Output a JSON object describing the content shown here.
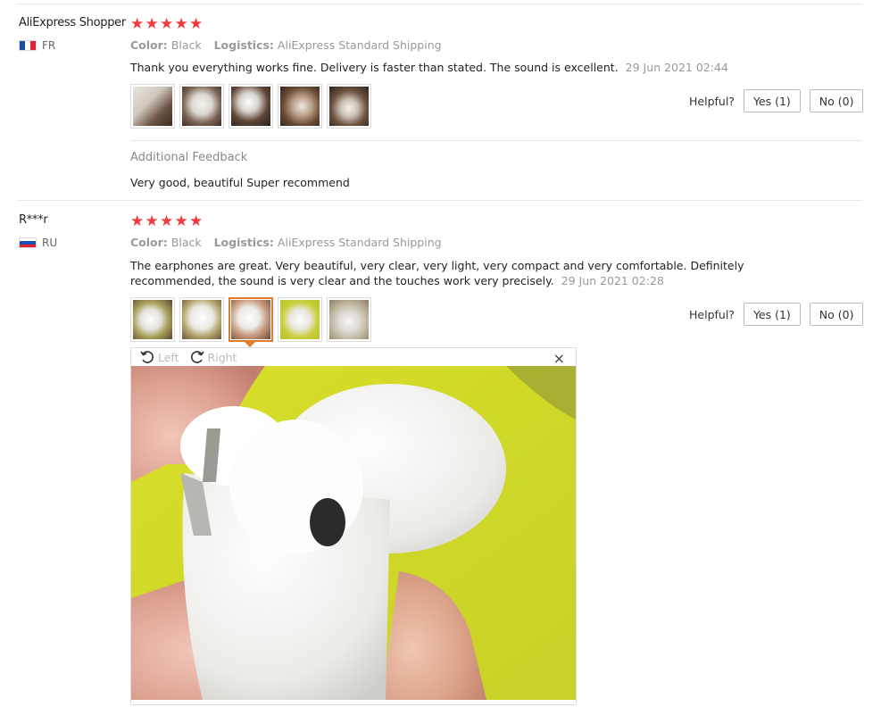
{
  "reviews": [
    {
      "user": "AliExpress Shopper",
      "country": "FR",
      "stars": 5,
      "color_label": "Color:",
      "color_value": "Black",
      "logistics_label": "Logistics:",
      "logistics_value": "AliExpress Standard Shipping",
      "text": "Thank you everything works fine. Delivery is faster than stated. The sound is excellent.",
      "date": "29 Jun 2021 02:44",
      "helpful_label": "Helpful?",
      "yes_label": "Yes (1)",
      "no_label": "No (0)",
      "additional_feedback_title": "Additional Feedback",
      "additional_feedback_text": "Very good, beautiful Super recommend"
    },
    {
      "user": "R***r",
      "country": "RU",
      "stars": 5,
      "color_label": "Color:",
      "color_value": "Black",
      "logistics_label": "Logistics:",
      "logistics_value": "AliExpress Standard Shipping",
      "text_line1": "The earphones are great. Very beautiful, very clear, very light, very compact and very comfortable. Definitely",
      "text_line2": "recommended, the sound is very clear and the touches work very precisely.",
      "date": "29 Jun 2021 02:28",
      "helpful_label": "Helpful?",
      "yes_label": "Yes (1)",
      "no_label": "No (0)"
    }
  ],
  "viewer": {
    "rotate_left": "Left",
    "rotate_right": "Right",
    "close": "×"
  },
  "icons": {
    "star": "★",
    "rotate_left": "rotate-left-icon",
    "rotate_right": "rotate-right-icon",
    "close": "close-icon"
  },
  "colors": {
    "star": "#f23c3c",
    "active_thumb_border": "#e07b2d"
  }
}
